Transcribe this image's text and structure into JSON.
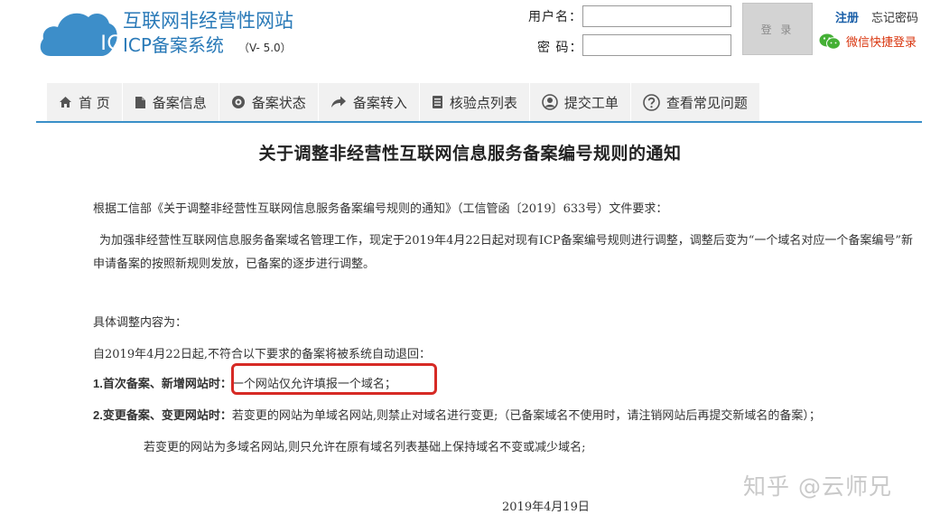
{
  "header": {
    "logo_text": "ICP",
    "site_name": "互联网非经营性网站",
    "system_name": "ICP备案系统",
    "version": "（V- 5.0）"
  },
  "login": {
    "username_label": "用户名：",
    "password_label": "密  码：",
    "username_value": "",
    "password_value": "",
    "login_button": "登 录",
    "register_link": "注册",
    "forgot_link": "忘记密码",
    "wechat_link": "微信快捷登录"
  },
  "nav": {
    "items": [
      {
        "label": "首 页",
        "icon": "home-icon"
      },
      {
        "label": "备案信息",
        "icon": "document-icon"
      },
      {
        "label": "备案状态",
        "icon": "status-icon"
      },
      {
        "label": "备案转入",
        "icon": "arrow-icon"
      },
      {
        "label": "核验点列表",
        "icon": "list-icon"
      },
      {
        "label": "提交工单",
        "icon": "user-icon"
      },
      {
        "label": "查看常见问题",
        "icon": "question-icon"
      }
    ]
  },
  "notice": {
    "title": "关于调整非经营性互联网信息服务备案编号规则的通知",
    "para1": "根据工信部《关于调整非经营性互联网信息服务备案编号规则的通知》（工信管函〔2019〕633号）文件要求：",
    "para2": "为加强非经营性互联网信息服务备案域名管理工作，现定于2019年4月22日起对现有ICP备案编号规则进行调整，调整后变为“一个域名对应一个备案编号”新申请备案的按照新规则发放，已备案的逐步进行调整。",
    "para3": "具体调整内容为：",
    "para4": "自2019年4月22日起,不符合以下要求的备案将被系统自动退回：",
    "item1_label": "1.首次备案、新增网站时：",
    "item1_text": "一个网站仅允许填报一个域名；",
    "item2_label": "2.变更备案、变更网站时：",
    "item2_text": "若变更的网站为单域名网站,则禁止对域名进行变更;（已备案域名不使用时，请注销网站后再提交新域名的备案）；",
    "item2_cont": "若变更的网站为多域名网站,则只允许在原有域名列表基础上保持域名不变或减少域名;",
    "date": "2019年4月19日"
  },
  "watermark": "知乎 @云师兄",
  "colors": {
    "brand_blue": "#2a7ab8",
    "nav_rule": "#3a8fc8",
    "highlight_red": "#d62a25",
    "wechat_red": "#d9360f",
    "wechat_green": "#44b035"
  }
}
